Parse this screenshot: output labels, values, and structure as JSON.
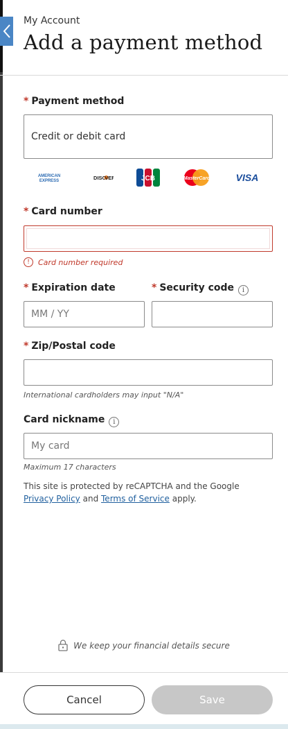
{
  "header": {
    "breadcrumb": "My Account",
    "title": "Add a payment method"
  },
  "form": {
    "payment_method": {
      "label": "Payment method",
      "value": "Credit or debit card"
    },
    "card_brands": [
      "AMERICAN EXPRESS",
      "DISCOVER",
      "JCB",
      "MasterCard",
      "VISA"
    ],
    "card_number": {
      "label": "Card number",
      "value": "",
      "error": "Card number required"
    },
    "expiration": {
      "label": "Expiration date",
      "placeholder": "MM / YY"
    },
    "security_code": {
      "label": "Security code",
      "value": ""
    },
    "zip": {
      "label": "Zip/Postal code",
      "value": "",
      "hint": "International cardholders may input \"N/A\""
    },
    "nickname": {
      "label": "Card nickname",
      "placeholder": "My card",
      "hint": "Maximum 17 characters"
    },
    "required_marker": "*",
    "info_glyph": "i",
    "error_glyph": "!"
  },
  "captcha": {
    "text_before": "This site is protected by reCAPTCHA and the Google",
    "privacy_link": "Privacy Policy",
    "and": "and",
    "terms_link": "Terms of Service",
    "apply": "apply."
  },
  "secure_note": "We keep your financial details secure",
  "footer": {
    "cancel_label": "Cancel",
    "save_label": "Save"
  },
  "colors": {
    "accent": "#4a86c5",
    "error": "#c0392b",
    "disabled": "#c7c7c7"
  },
  "icons": {
    "back": "chevron-left-icon",
    "info": "info-icon",
    "error": "error-icon",
    "lock": "lock-icon"
  }
}
